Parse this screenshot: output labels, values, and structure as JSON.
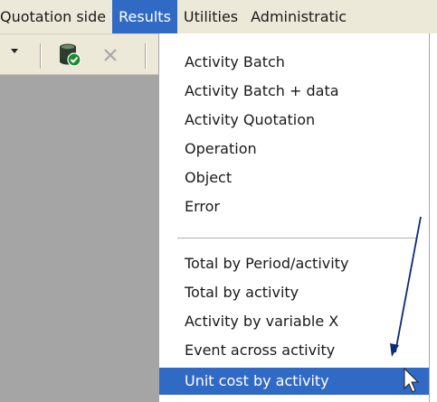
{
  "menubar": {
    "items": [
      {
        "label": "Quotation side"
      },
      {
        "label": "Results"
      },
      {
        "label": "Utilities"
      },
      {
        "label": "Administratic"
      }
    ]
  },
  "dropdown": {
    "group1": [
      {
        "label": "Activity Batch"
      },
      {
        "label": "Activity Batch + data"
      },
      {
        "label": "Activity Quotation"
      },
      {
        "label": "Operation"
      },
      {
        "label": "Object"
      },
      {
        "label": "Error"
      }
    ],
    "group2": [
      {
        "label": "Total by Period/activity"
      },
      {
        "label": "Total by activity"
      },
      {
        "label": "Activity by variable X"
      },
      {
        "label": "Event across activity"
      },
      {
        "label": "Unit cost by activity"
      }
    ]
  },
  "icons": {
    "toolbar": [
      "dropdown-arrow-icon",
      "database-check-icon",
      "close-icon"
    ],
    "annotation": [
      "arrow-annotation-icon",
      "mouse-pointer-icon"
    ]
  },
  "colors": {
    "highlight": "#316ac5",
    "menubar_bg": "#ede9d8",
    "workspace_bg": "#a5a5a5",
    "annotation_arrow": "#0a2a7a"
  }
}
